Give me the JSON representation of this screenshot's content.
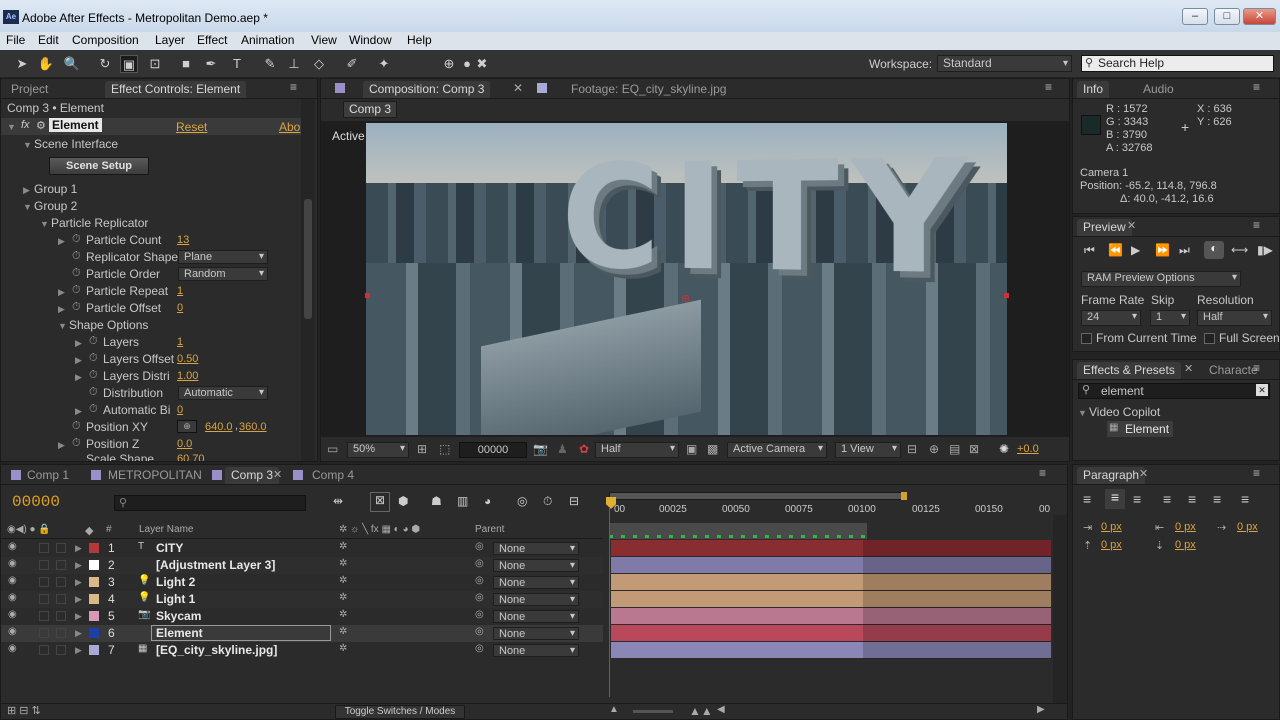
{
  "app": {
    "title": "Adobe After Effects - Metropolitan Demo.aep *",
    "logo": "Ae"
  },
  "menu": [
    "File",
    "Edit",
    "Composition",
    "Layer",
    "Effect",
    "Animation",
    "View",
    "Window",
    "Help"
  ],
  "toolbar": {
    "workspace_label": "Workspace:",
    "workspace_value": "Standard",
    "search_placeholder": "Search Help"
  },
  "project_tab": "Project",
  "effect_controls": {
    "tab": "Effect Controls: Element",
    "breadcrumb": "Comp 3 • Element",
    "effect_name": "Element",
    "reset": "Reset",
    "about": "Abo",
    "scene_interface": "Scene Interface",
    "scene_setup": "Scene Setup",
    "group1": "Group 1",
    "group2": "Group 2",
    "particle_replicator": "Particle Replicator",
    "rows": [
      {
        "label": "Particle Count",
        "value": "13"
      },
      {
        "label": "Replicator Shape",
        "dropdown": "Plane"
      },
      {
        "label": "Particle Order",
        "dropdown": "Random"
      },
      {
        "label": "Particle Repeat",
        "value": "1"
      },
      {
        "label": "Particle Offset",
        "value": "0"
      }
    ],
    "shape_options": "Shape Options",
    "shape_rows": [
      {
        "label": "Layers",
        "value": "1"
      },
      {
        "label": "Layers Offset",
        "value": "0.50"
      },
      {
        "label": "Layers Distri",
        "value": "1.00"
      },
      {
        "label": "Distribution",
        "dropdown": "Automatic"
      },
      {
        "label": "Automatic Bi",
        "value": "0"
      }
    ],
    "position_xy_label": "Position XY",
    "position_xy_x": "640.0",
    "position_xy_y": "360.0",
    "position_z_label": "Position Z",
    "position_z_value": "0.0",
    "scale_shape_label": "Scale Shape",
    "scale_shape_value": "60.70"
  },
  "composition": {
    "tab": "Composition: Comp 3",
    "footage_tab": "Footage: EQ_city_skyline.jpg",
    "comp_button": "Comp 3",
    "camera_label": "Active Camera",
    "sign_text": "CITY",
    "zoom": "50%",
    "timecode": "00000",
    "resolution": "Half",
    "camera": "Active Camera",
    "views": "1 View",
    "exposure": "+0.0"
  },
  "info": {
    "tab": "Info",
    "audio_tab": "Audio",
    "r": "R : 1572",
    "g": "G : 3343",
    "b": "B : 3790",
    "a": "A : 32768",
    "x": "X : 636",
    "y": "Y : 626",
    "camera": "Camera 1",
    "position": "Position: -65.2, 114.8, 796.8",
    "delta": "Δ: 40.0, -41.2, 16.6"
  },
  "preview": {
    "tab": "Preview",
    "options": "RAM Preview Options",
    "frame_rate_label": "Frame Rate",
    "frame_rate": "24",
    "skip_label": "Skip",
    "skip": "1",
    "resolution_label": "Resolution",
    "resolution": "Half",
    "from_current": "From Current Time",
    "full_screen": "Full Screen"
  },
  "effects_presets": {
    "tab": "Effects & Presets",
    "char_tab": "Characte",
    "search": "element",
    "folder": "Video Copilot",
    "item": "Element"
  },
  "timeline": {
    "tabs": [
      "Comp 1",
      "METROPOLITAN",
      "Comp 3",
      "Comp 4"
    ],
    "timecode": "00000",
    "col_layer_name": "Layer Name",
    "col_parent": "Parent",
    "col_num": "#",
    "ruler": [
      "00",
      "00025",
      "00050",
      "00075",
      "00100",
      "00125",
      "00150",
      "00"
    ],
    "layers": [
      {
        "num": "1",
        "name": "CITY",
        "parent": "None",
        "color": "#b33a3a",
        "bar": "#8a2d31",
        "icon": "T"
      },
      {
        "num": "2",
        "name": "[Adjustment Layer 3]",
        "parent": "None",
        "color": "#ffffff",
        "bar": "#7f7aa8",
        "icon": ""
      },
      {
        "num": "3",
        "name": "Light 2",
        "parent": "None",
        "color": "#d9b98a",
        "bar": "#c29a76",
        "icon": "💡"
      },
      {
        "num": "4",
        "name": "Light 1",
        "parent": "None",
        "color": "#d9b98a",
        "bar": "#c29a76",
        "icon": "💡"
      },
      {
        "num": "5",
        "name": "Skycam",
        "parent": "None",
        "color": "#d69ab4",
        "bar": "#b97890",
        "icon": "📷"
      },
      {
        "num": "6",
        "name": "Element",
        "parent": "None",
        "color": "#1f3fa8",
        "bar": "#b8485a",
        "icon": ""
      },
      {
        "num": "7",
        "name": "[EQ_city_skyline.jpg]",
        "parent": "None",
        "color": "#a9a9d6",
        "bar": "#8a87b6",
        "icon": "▦"
      }
    ],
    "toggle": "Toggle Switches / Modes"
  },
  "paragraph": {
    "tab": "Paragraph",
    "px1": "0 px",
    "px2": "0 px",
    "px3": "0 px",
    "px4": "0 px",
    "px5": "0 px"
  }
}
